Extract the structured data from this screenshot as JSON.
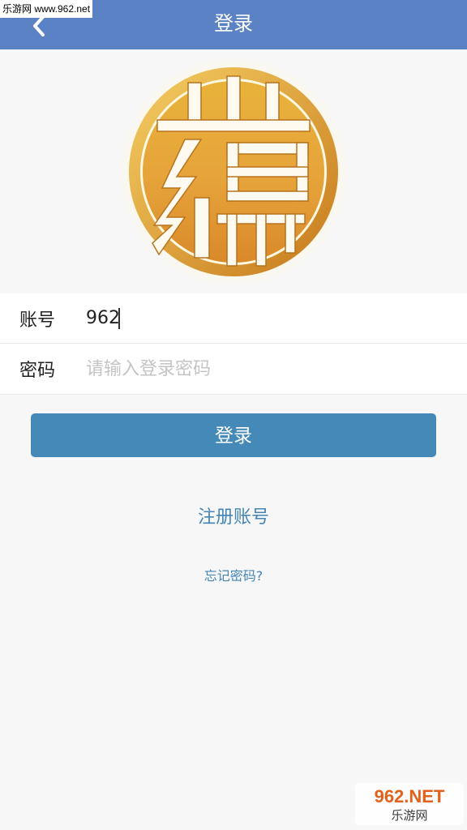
{
  "watermark_top": "乐游网 www.962.net",
  "header": {
    "title": "登录",
    "back_icon": "chevron-left-icon"
  },
  "logo": {
    "icon": "gold-seal-logo",
    "colors": {
      "gold_light": "#f2c94c",
      "gold_dark": "#c9821e",
      "glow": "#fff6d8"
    }
  },
  "form": {
    "account_label": "账号",
    "account_value": "962",
    "password_label": "密码",
    "password_placeholder": "请输入登录密码"
  },
  "login_button": "登录",
  "register_link": "注册账号",
  "forgot_link": "忘记密码?",
  "watermark_bottom": {
    "brand": "962.NET",
    "site": "乐游网"
  },
  "colors": {
    "header_bg": "#5a82c4",
    "button_bg": "#4589b8",
    "link": "#4585b5",
    "page_bg": "#f7f7f7"
  }
}
